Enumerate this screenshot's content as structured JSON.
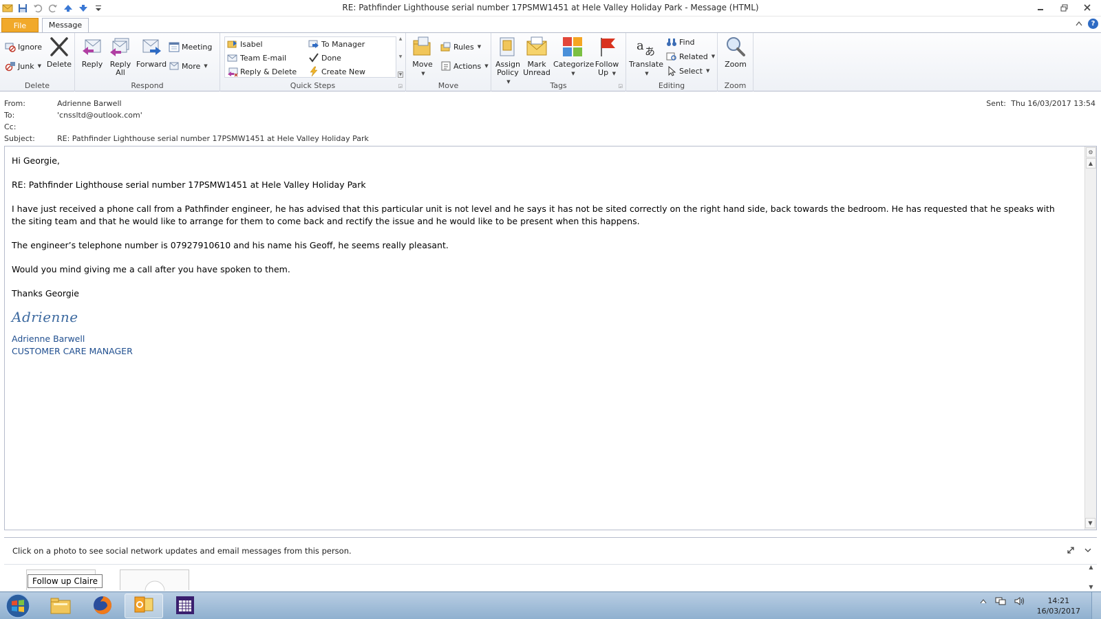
{
  "window": {
    "title": "RE: Pathfinder Lighthouse serial number 17PSMW1451 at Hele Valley Holiday Park  -  Message (HTML)"
  },
  "ribbon": {
    "tabs": {
      "file": "File",
      "message": "Message"
    },
    "groups": {
      "delete": {
        "label": "Delete",
        "ignore": "Ignore",
        "junk": "Junk",
        "delete": "Delete"
      },
      "respond": {
        "label": "Respond",
        "reply": "Reply",
        "reply_all_1": "Reply",
        "reply_all_2": "All",
        "forward": "Forward",
        "meeting": "Meeting",
        "more": "More"
      },
      "quick_steps": {
        "label": "Quick Steps",
        "items": [
          "Isabel",
          "Team E-mail",
          "Reply & Delete",
          "To Manager",
          "Done",
          "Create New"
        ]
      },
      "move": {
        "label": "Move",
        "move": "Move",
        "rules": "Rules",
        "actions": "Actions"
      },
      "tags": {
        "label": "Tags",
        "assign_1": "Assign",
        "assign_2": "Policy",
        "mark_1": "Mark",
        "mark_2": "Unread",
        "categorize": "Categorize",
        "follow_1": "Follow",
        "follow_2": "Up"
      },
      "editing": {
        "label": "Editing",
        "translate": "Translate",
        "find": "Find",
        "related": "Related",
        "select": "Select"
      },
      "zoom": {
        "label": "Zoom",
        "zoom": "Zoom"
      }
    }
  },
  "header": {
    "from_label": "From:",
    "from": "Adrienne Barwell",
    "to_label": "To:",
    "to": "'cnssltd@outlook.com'",
    "cc_label": "Cc:",
    "cc": "",
    "subject_label": "Subject:",
    "subject": "RE: Pathfinder Lighthouse serial number 17PSMW1451 at Hele Valley Holiday Park",
    "sent_label": "Sent:",
    "sent": "Thu 16/03/2017 13:54"
  },
  "body": {
    "greeting": "Hi Georgie,",
    "subject_line": "RE: Pathfinder Lighthouse serial number 17PSMW1451 at Hele Valley Holiday Park",
    "para1": "I have just received a phone call from a Pathfinder engineer, he has advised that this particular unit is not level and he says it has not be sited correctly on the right hand side, back towards the bedroom.  He has requested that he speaks with the siting team and that he would like to arrange for them to come back and rectify the issue and he would like to be present when this happens.",
    "para2": "The engineer’s telephone number is 07927910610 and his name his Geoff, he seems really pleasant.",
    "para3": "Would you mind giving me a call after you have spoken to them.",
    "closing": "Thanks Georgie",
    "signature_script": "Adrienne",
    "signature_name": "Adrienne Barwell",
    "signature_title": "CUSTOMER CARE MANAGER"
  },
  "people_pane": {
    "message": "Click on a photo to see social network updates and email messages from this person.",
    "tooltip": "Follow up Claire"
  },
  "taskbar": {
    "time": "14:21",
    "date": "16/03/2017"
  }
}
